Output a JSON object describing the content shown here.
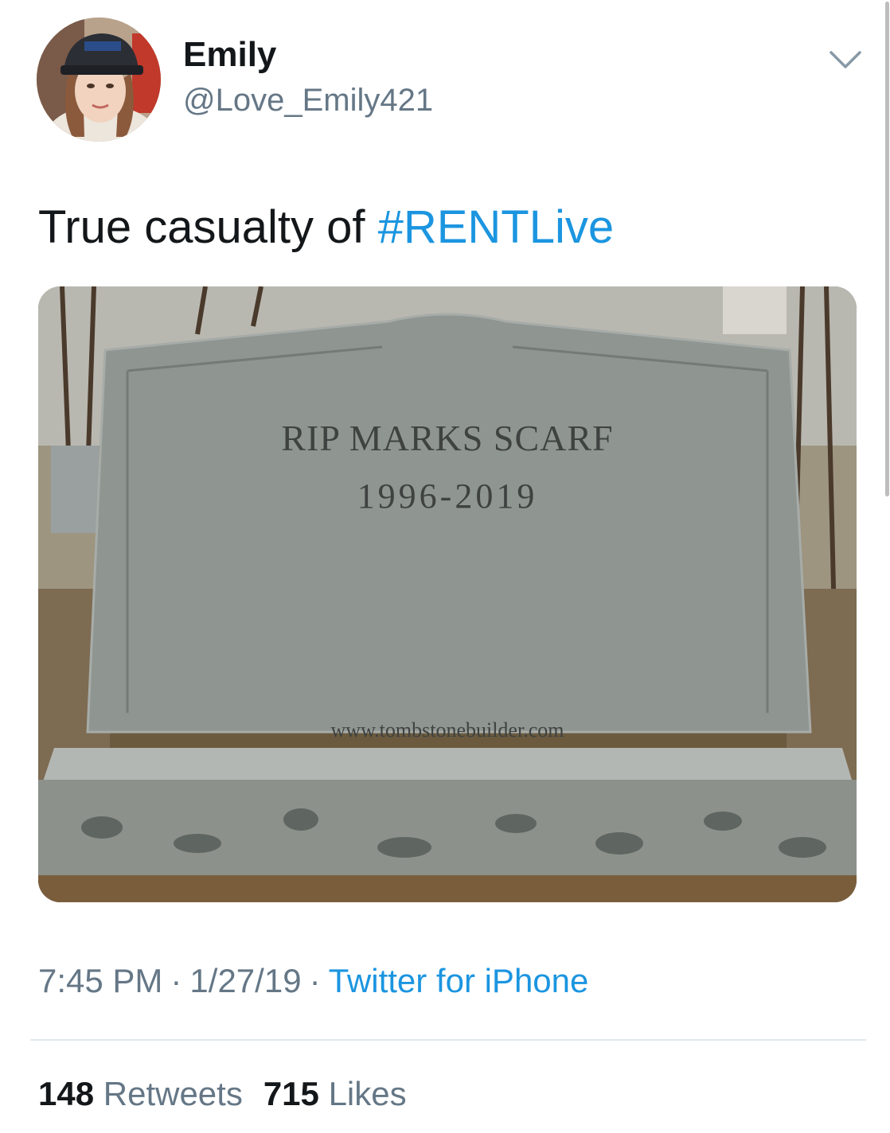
{
  "author": {
    "display_name": "Emily",
    "handle": "@Love_Emily421"
  },
  "tweet": {
    "text": "True casualty of ",
    "hashtag": "#RENTLive"
  },
  "media": {
    "headstone_line1": "RIP MARKS SCARF",
    "headstone_line2": "1996-2019",
    "watermark": "www.tombstonebuilder.com"
  },
  "meta": {
    "time": "7:45 PM",
    "separator": "·",
    "date": "1/27/19",
    "source": "Twitter for iPhone"
  },
  "stats": {
    "retweets_count": "148",
    "retweets_label": "Retweets",
    "likes_count": "715",
    "likes_label": "Likes"
  },
  "icons": {
    "menu": "chevron-down-icon"
  },
  "colors": {
    "link": "#1b95e0",
    "secondary_text": "#657786",
    "primary_text": "#14171a"
  }
}
